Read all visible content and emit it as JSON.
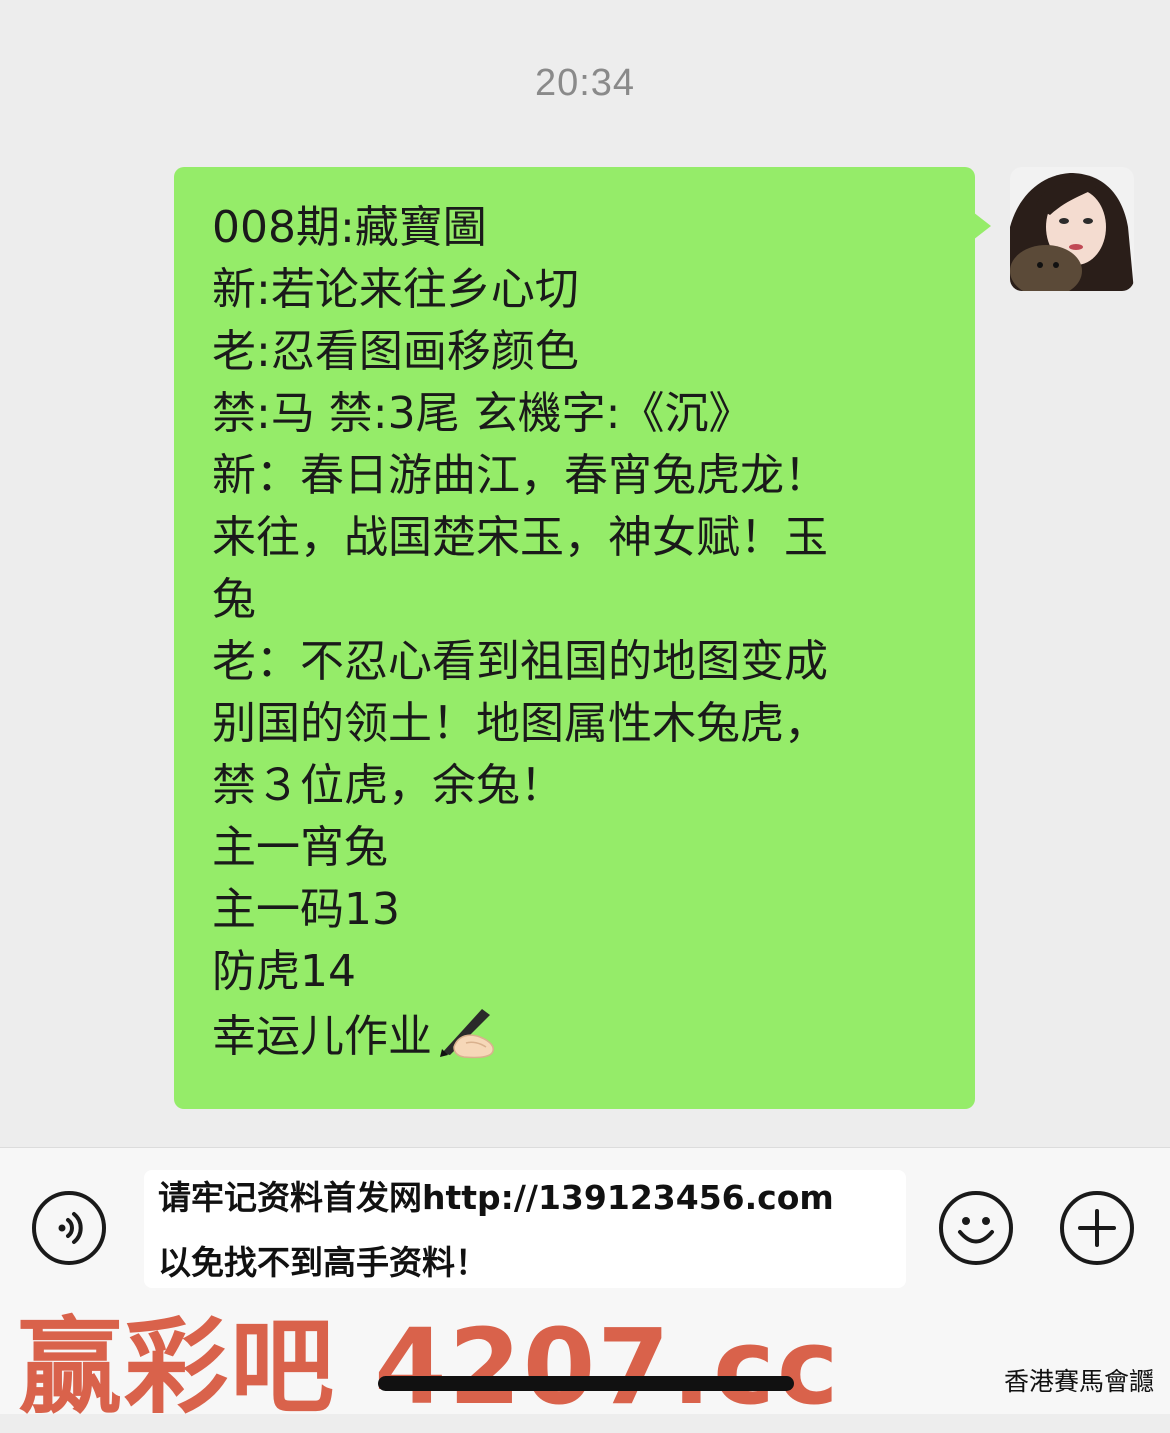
{
  "chat": {
    "timestamp": "20:34",
    "message": {
      "lines": [
        "008期:藏寶圖",
        "新:若论来往乡心切",
        "老:忍看图画移颜色",
        "禁:马 禁:3尾 玄機字:《沉》",
        "新：春日游曲江，春宵兔虎龙！",
        "来往，战国楚宋玉，神女赋！玉",
        "兔",
        "老：不忍心看到祖国的地图变成",
        "别国的领土！地图属性木兔虎，",
        "禁３位虎，余兔！",
        "主一宵兔",
        "主一码13",
        "防虎14",
        "幸运儿作业"
      ],
      "trailing_emoji": "writing-hand"
    }
  },
  "input_bar": {
    "text_line1": "请牢记资料首发网http://139123456.com",
    "text_line2": "以免找不到高手资料！"
  },
  "overlay": {
    "watermark": "赢彩吧 4207.cc",
    "corner_mark": "香港賽馬會讔"
  },
  "colors": {
    "bubble": "#95ec69",
    "watermark": "#d9624b",
    "background": "#ededed"
  }
}
